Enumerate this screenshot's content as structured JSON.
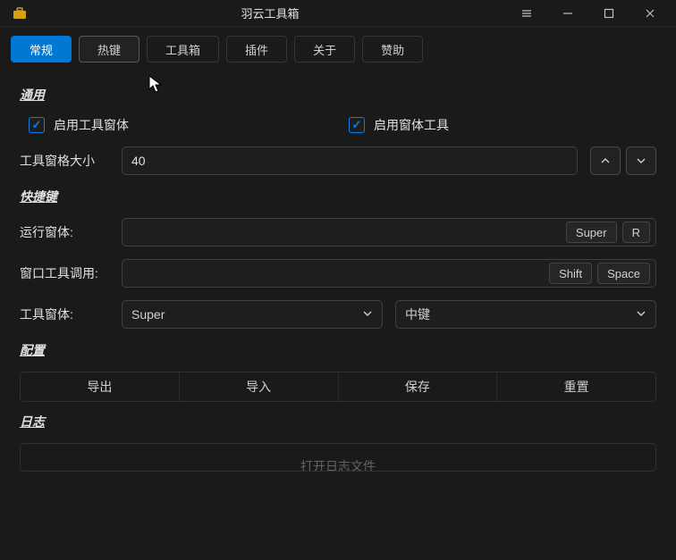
{
  "titlebar": {
    "app_title": "羽云工具箱"
  },
  "tabs": {
    "general": "常规",
    "hotkeys": "热键",
    "toolbox": "工具箱",
    "plugins": "插件",
    "about": "关于",
    "sponsor": "赞助"
  },
  "sections": {
    "general": "通用",
    "shortcuts": "快捷键",
    "config": "配置",
    "log": "日志"
  },
  "general": {
    "enable_tool_window": "启用工具窗体",
    "enable_window_tool": "启用窗体工具",
    "pane_size_label": "工具窗格大小",
    "pane_size_value": "40"
  },
  "shortcuts": {
    "run_window_label": "运行窗体:",
    "run_window_keys": [
      "Super",
      "R"
    ],
    "window_tool_call_label": "窗口工具调用:",
    "window_tool_call_keys": [
      "Shift",
      "Space"
    ],
    "tool_window_label": "工具窗体:",
    "modifier_value": "Super",
    "button_value": "中键"
  },
  "config": {
    "export": "导出",
    "import": "导入",
    "save": "保存",
    "reset": "重置"
  },
  "log": {
    "open_file": "打开日志文件"
  }
}
